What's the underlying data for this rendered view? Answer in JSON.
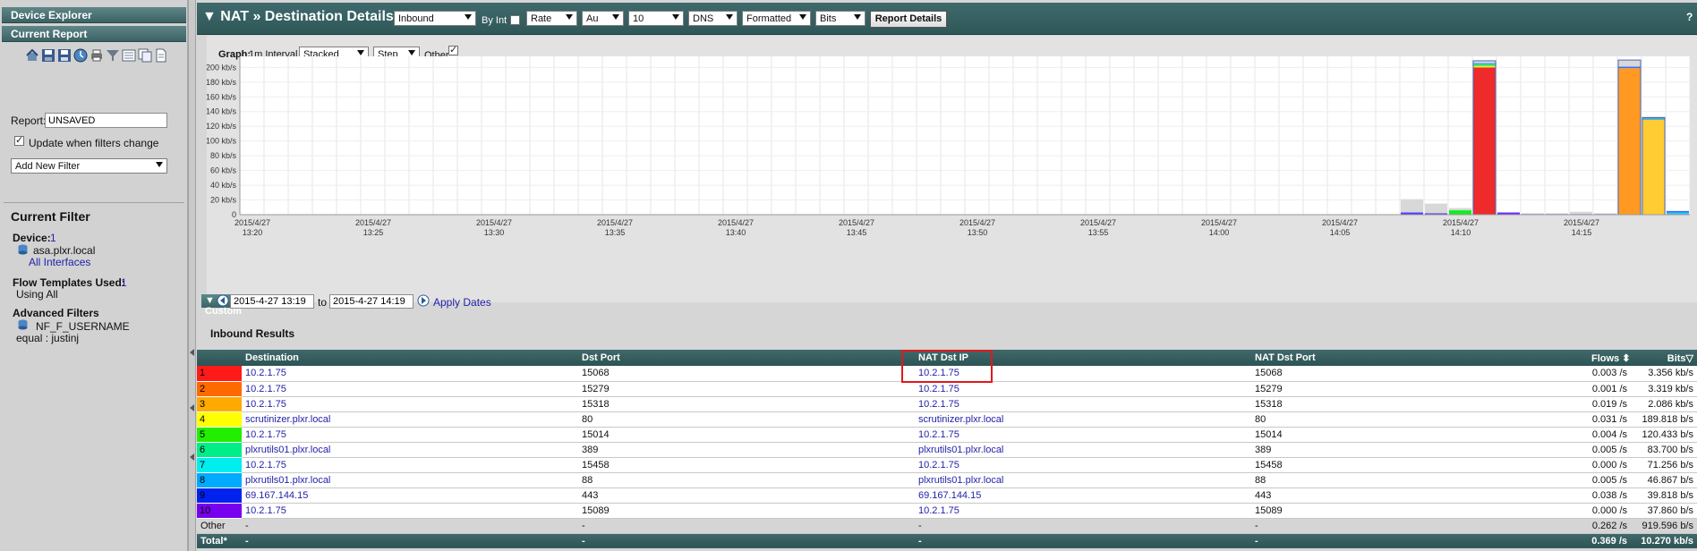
{
  "left_panel": {
    "device_explorer": "Device Explorer",
    "current_report": "Current Report",
    "report_label": "Report:",
    "report_value": "UNSAVED",
    "update_label": "Update when filters change",
    "add_filter": "Add New Filter",
    "current_filter": "Current Filter",
    "device_label": "Device:",
    "device_count": "1",
    "device_name": "asa.plxr.local",
    "all_interfaces": "All Interfaces",
    "flow_templates_label": "Flow Templates Used:",
    "flow_templates_count": "1",
    "using_all": "Using All",
    "advanced_filters": "Advanced Filters",
    "filter_name": "NF_F_USERNAME",
    "filter_value": "equal : justinj",
    "tool_icons": [
      "export-icon",
      "save-icon",
      "save-as-icon",
      "schedule-icon",
      "print-icon",
      "filter-icon",
      "report-list-icon",
      "copy-icon",
      "document-icon"
    ]
  },
  "header": {
    "title": "NAT » Destination Details",
    "direction": "Inbound",
    "by_int": "By Int",
    "rate": "Rate",
    "au": "Au",
    "top_n": "10",
    "dns": "DNS",
    "formatted": "Formatted",
    "bits": "Bits",
    "report_details": "Report Details",
    "help": "?"
  },
  "graph": {
    "label": "Graph:",
    "interval": "1m Interval",
    "stacked": "Stacked",
    "step": "Step",
    "other": "Other"
  },
  "chart_data": {
    "type": "bar",
    "ylim": [
      0,
      215
    ],
    "ytick_labels": [
      "0",
      "20 kb/s",
      "40 kb/s",
      "60 kb/s",
      "80 kb/s",
      "100 kb/s",
      "120 kb/s",
      "140 kb/s",
      "160 kb/s",
      "180 kb/s",
      "200 kb/s"
    ],
    "yticks": [
      0,
      20,
      40,
      60,
      80,
      100,
      120,
      140,
      160,
      180,
      200
    ],
    "xticks": [
      {
        "d": "2015/4/27",
        "t": "13:20"
      },
      {
        "d": "2015/4/27",
        "t": "13:25"
      },
      {
        "d": "2015/4/27",
        "t": "13:30"
      },
      {
        "d": "2015/4/27",
        "t": "13:35"
      },
      {
        "d": "2015/4/27",
        "t": "13:40"
      },
      {
        "d": "2015/4/27",
        "t": "13:45"
      },
      {
        "d": "2015/4/27",
        "t": "13:50"
      },
      {
        "d": "2015/4/27",
        "t": "13:55"
      },
      {
        "d": "2015/4/27",
        "t": "14:00"
      },
      {
        "d": "2015/4/27",
        "t": "14:05"
      },
      {
        "d": "2015/4/27",
        "t": "14:10"
      },
      {
        "d": "2015/4/27",
        "t": "14:15"
      }
    ],
    "time_start": "13:19",
    "time_end": "14:19",
    "bars": [
      {
        "time": "14:08",
        "segments": [
          {
            "color": "#4a3aff",
            "value": 3
          },
          {
            "color": "#d8d8d8",
            "value": 18
          }
        ]
      },
      {
        "time": "14:09",
        "segments": [
          {
            "color": "#4a3aff",
            "value": 2
          },
          {
            "color": "#d8d8d8",
            "value": 13
          }
        ]
      },
      {
        "time": "14:10",
        "segments": [
          {
            "color": "#11ee22",
            "value": 6
          },
          {
            "color": "#d8d8d8",
            "value": 3
          }
        ]
      },
      {
        "time": "14:11",
        "segments": [
          {
            "color": "#ee2a2a",
            "value": 200
          },
          {
            "color": "#f7e92a",
            "value": 2
          },
          {
            "color": "#22ee44",
            "value": 2
          },
          {
            "color": "#44aaee",
            "value": 2
          },
          {
            "color": "#d8d8d8",
            "value": 3
          }
        ]
      },
      {
        "time": "14:12",
        "segments": [
          {
            "color": "#6a2aff",
            "value": 3
          }
        ]
      },
      {
        "time": "14:13",
        "segments": [
          {
            "color": "#6a6aff",
            "value": 1
          },
          {
            "color": "#d8d8d8",
            "value": 1
          }
        ]
      },
      {
        "time": "14:14",
        "segments": [
          {
            "color": "#6a6aff",
            "value": 1
          },
          {
            "color": "#d8d8d8",
            "value": 1
          }
        ]
      },
      {
        "time": "14:15",
        "segments": [
          {
            "color": "#6a6aff",
            "value": 1
          },
          {
            "color": "#d8d8d8",
            "value": 3
          }
        ]
      },
      {
        "time": "14:16",
        "segments": [
          {
            "color": "#6a6aff",
            "value": 1
          },
          {
            "color": "#d8d8d8",
            "value": 1
          }
        ]
      },
      {
        "time": "14:17",
        "segments": [
          {
            "color": "#ff9922",
            "value": 199
          },
          {
            "color": "#3a6aff",
            "value": 2
          },
          {
            "color": "#d8d8d8",
            "value": 9
          }
        ]
      },
      {
        "time": "14:18",
        "segments": [
          {
            "color": "#ffcc33",
            "value": 129
          },
          {
            "color": "#22aacc",
            "value": 2
          },
          {
            "color": "#6a6aff",
            "value": 1
          }
        ]
      },
      {
        "time": "14:19",
        "segments": [
          {
            "color": "#22ccee",
            "value": 3
          },
          {
            "color": "#3a6aff",
            "value": 2
          }
        ]
      }
    ]
  },
  "dates": {
    "custom": "Custom",
    "from": "2015-4-27 13:19",
    "to_label": "to",
    "to": "2015-4-27 14:19",
    "apply": "Apply Dates"
  },
  "results": {
    "title": "Inbound Results",
    "columns": [
      "Destination",
      "Dst Port",
      "NAT Dst IP",
      "NAT Dst Port",
      "Flows",
      "Bits"
    ],
    "rows": [
      {
        "rank": "1",
        "color": "#ff1a1a",
        "dest": "10.2.1.75",
        "dport": "15068",
        "nat_ip": "10.2.1.75",
        "nat_port": "15068",
        "flows": "0.003 /s",
        "bits": "3.356 kb/s"
      },
      {
        "rank": "2",
        "color": "#ff6a00",
        "dest": "10.2.1.75",
        "dport": "15279",
        "nat_ip": "10.2.1.75",
        "nat_port": "15279",
        "flows": "0.001 /s",
        "bits": "3.319 kb/s"
      },
      {
        "rank": "3",
        "color": "#ffaa00",
        "dest": "10.2.1.75",
        "dport": "15318",
        "nat_ip": "10.2.1.75",
        "nat_port": "15318",
        "flows": "0.019 /s",
        "bits": "2.086 kb/s"
      },
      {
        "rank": "4",
        "color": "#ffff00",
        "dest": "scrutinizer.plxr.local",
        "dport": "80",
        "nat_ip": "scrutinizer.plxr.local",
        "nat_port": "80",
        "flows": "0.031 /s",
        "bits": "189.818 b/s"
      },
      {
        "rank": "5",
        "color": "#22ee00",
        "dest": "10.2.1.75",
        "dport": "15014",
        "nat_ip": "10.2.1.75",
        "nat_port": "15014",
        "flows": "0.004 /s",
        "bits": "120.433 b/s"
      },
      {
        "rank": "6",
        "color": "#00ee88",
        "dest": "plxrutils01.plxr.local",
        "dport": "389",
        "nat_ip": "plxrutils01.plxr.local",
        "nat_port": "389",
        "flows": "0.005 /s",
        "bits": "83.700 b/s"
      },
      {
        "rank": "7",
        "color": "#00eeee",
        "dest": "10.2.1.75",
        "dport": "15458",
        "nat_ip": "10.2.1.75",
        "nat_port": "15458",
        "flows": "0.000 /s",
        "bits": "71.256 b/s"
      },
      {
        "rank": "8",
        "color": "#00aaff",
        "dest": "plxrutils01.plxr.local",
        "dport": "88",
        "nat_ip": "plxrutils01.plxr.local",
        "nat_port": "88",
        "flows": "0.005 /s",
        "bits": "46.867 b/s"
      },
      {
        "rank": "9",
        "color": "#0022ee",
        "dest": "69.167.144.15",
        "dport": "443",
        "nat_ip": "69.167.144.15",
        "nat_port": "443",
        "flows": "0.038 /s",
        "bits": "39.818 b/s"
      },
      {
        "rank": "10",
        "color": "#7700ee",
        "dest": "10.2.1.75",
        "dport": "15089",
        "nat_ip": "10.2.1.75",
        "nat_port": "15089",
        "flows": "0.000 /s",
        "bits": "37.860 b/s"
      }
    ],
    "other": {
      "label": "Other",
      "dest": "-",
      "dport": "-",
      "nat_ip": "-",
      "nat_port": "-",
      "flows": "0.262 /s",
      "bits": "919.596 b/s"
    },
    "total": {
      "label": "Total*",
      "dest": "-",
      "dport": "-",
      "nat_ip": "-",
      "nat_port": "-",
      "flows": "0.369 /s",
      "bits": "10.270 kb/s"
    }
  }
}
